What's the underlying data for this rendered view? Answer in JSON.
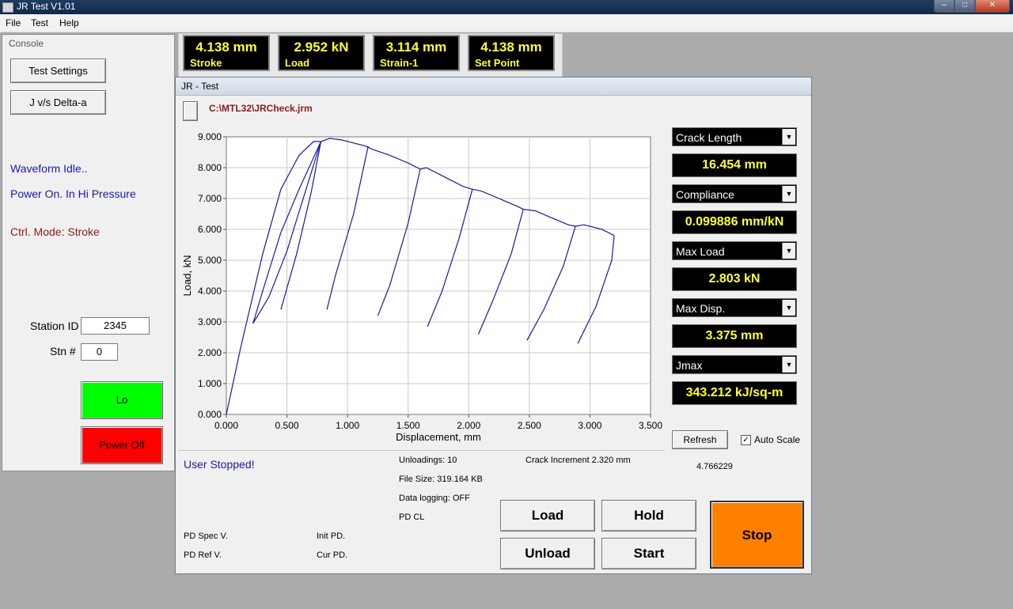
{
  "titlebar": {
    "title": "JR Test  V1.01",
    "min": "–",
    "max": "□",
    "close": "✕"
  },
  "menu": {
    "file": "File",
    "test": "Test",
    "help": "Help"
  },
  "console": {
    "title": "Console",
    "test_settings": "Test Settings",
    "j_vs_delta": "J v/s Delta-a",
    "waveform": "Waveform Idle..",
    "power": "Power On. In Hi Pressure",
    "ctrl_mode": "Ctrl. Mode: Stroke",
    "station_id_label": "Station ID",
    "station_id_value": "2345",
    "stn_label": "Stn #",
    "stn_value": "0",
    "lo_button": "Lo",
    "power_off_button": "Power Off",
    "colors": {
      "lo": "#00ff00",
      "power_off": "#ff0000",
      "status_blue": "#1a1aa8",
      "status_red": "#8b1a1a"
    }
  },
  "readouts": [
    {
      "value": "4.138 mm",
      "label": "Stroke"
    },
    {
      "value": "2.952 kN",
      "label": "Load"
    },
    {
      "value": "3.114 mm",
      "label": "Strain-1"
    },
    {
      "value": "4.138 mm",
      "label": "Set Point"
    }
  ],
  "jr": {
    "title": "JR - Test",
    "file_path": "C:\\MTL32\\JRCheck.jrm",
    "selectors": [
      {
        "label": "Crack Length",
        "value": "16.454 mm"
      },
      {
        "label": "Compliance",
        "value": "0.099886 mm/kN"
      },
      {
        "label": "Max Load",
        "value": "2.803 kN"
      },
      {
        "label": "Max Disp.",
        "value": "3.375 mm"
      },
      {
        "label": "Jmax",
        "value": "343.212 kJ/sq-m"
      }
    ],
    "refresh": "Refresh",
    "auto_scale": "Auto Scale",
    "auto_scale_checked": true,
    "status": "User Stopped!",
    "unloadings": "Unloadings: 10",
    "file_size": "File Size:  319.164 KB",
    "data_logging": "Data logging: OFF",
    "pd_cl": "PD CL",
    "crack_increment": "Crack Increment 2.320 mm",
    "extra_value": "4.766229",
    "pd_spec": "PD Spec V.",
    "pd_ref": "PD Ref V.",
    "init_pd": "Init PD.",
    "cur_pd": "Cur PD.",
    "buttons": {
      "load": "Load",
      "hold": "Hold",
      "unload": "Unload",
      "start": "Start",
      "stop": "Stop"
    },
    "colors": {
      "stop": "#ff8000",
      "path": "#8b1a1a",
      "status": "#1a1aa8"
    }
  },
  "chart_data": {
    "type": "line",
    "title": "",
    "xlabel": "Displacement, mm",
    "ylabel": "Load, kN",
    "xlim": [
      0,
      3.5
    ],
    "ylim": [
      0,
      9
    ],
    "x_ticks": [
      "0.000",
      "0.500",
      "1.000",
      "1.500",
      "2.000",
      "2.500",
      "3.000",
      "3.500"
    ],
    "y_ticks": [
      "0.000",
      "1.000",
      "2.000",
      "3.000",
      "4.000",
      "5.000",
      "6.000",
      "7.000",
      "8.000",
      "9.000"
    ],
    "grid": true,
    "line_color": "#1a1a9a",
    "series": [
      {
        "x": [
          0,
          0.12,
          0.3,
          0.45,
          0.6,
          0.72,
          0.78
        ],
        "y": [
          0,
          2.2,
          5.2,
          7.3,
          8.4,
          8.85,
          8.85
        ]
      },
      {
        "x": [
          0.78,
          0.85,
          0.95,
          1.05,
          1.15
        ],
        "y": [
          8.85,
          8.95,
          8.9,
          8.8,
          8.7
        ]
      },
      {
        "x": [
          1.15,
          1.2,
          1.35,
          1.5,
          1.6
        ],
        "y": [
          8.7,
          8.6,
          8.4,
          8.15,
          7.95
        ]
      },
      {
        "x": [
          1.6,
          1.65,
          1.8,
          1.95,
          2.03
        ],
        "y": [
          7.95,
          8.0,
          7.7,
          7.4,
          7.3
        ]
      },
      {
        "x": [
          2.03,
          2.1,
          2.25,
          2.4,
          2.45
        ],
        "y": [
          7.3,
          7.25,
          7.0,
          6.75,
          6.65
        ]
      },
      {
        "x": [
          2.45,
          2.55,
          2.7,
          2.82,
          2.88
        ],
        "y": [
          6.65,
          6.6,
          6.35,
          6.15,
          6.1
        ]
      },
      {
        "x": [
          2.88,
          2.95,
          3.1,
          3.2
        ],
        "y": [
          6.1,
          6.15,
          6.0,
          5.8
        ]
      },
      {
        "x": [
          3.2,
          3.18,
          3.05,
          2.9
        ],
        "y": [
          5.8,
          5.0,
          3.5,
          2.3
        ]
      },
      {
        "x": [
          0.78,
          0.65,
          0.5,
          0.35,
          0.22
        ],
        "y": [
          8.85,
          7.2,
          5.3,
          3.8,
          2.95
        ]
      },
      {
        "x": [
          0.22,
          0.3,
          0.45,
          0.6,
          0.78
        ],
        "y": [
          2.95,
          4.0,
          5.9,
          7.3,
          8.85
        ]
      },
      {
        "x": [
          0.78,
          0.7,
          0.58,
          0.45
        ],
        "y": [
          8.85,
          7.2,
          5.2,
          3.4
        ]
      },
      {
        "x": [
          1.17,
          1.05,
          0.9,
          0.83
        ],
        "y": [
          8.7,
          6.5,
          4.5,
          3.4
        ]
      },
      {
        "x": [
          1.6,
          1.5,
          1.35,
          1.25
        ],
        "y": [
          7.95,
          6.2,
          4.2,
          3.2
        ]
      },
      {
        "x": [
          2.03,
          1.92,
          1.78,
          1.66
        ],
        "y": [
          7.3,
          5.7,
          4.0,
          2.85
        ]
      },
      {
        "x": [
          2.45,
          2.35,
          2.2,
          2.08
        ],
        "y": [
          6.65,
          5.2,
          3.7,
          2.6
        ]
      },
      {
        "x": [
          2.88,
          2.78,
          2.62,
          2.48
        ],
        "y": [
          6.1,
          4.8,
          3.4,
          2.4
        ]
      }
    ]
  }
}
